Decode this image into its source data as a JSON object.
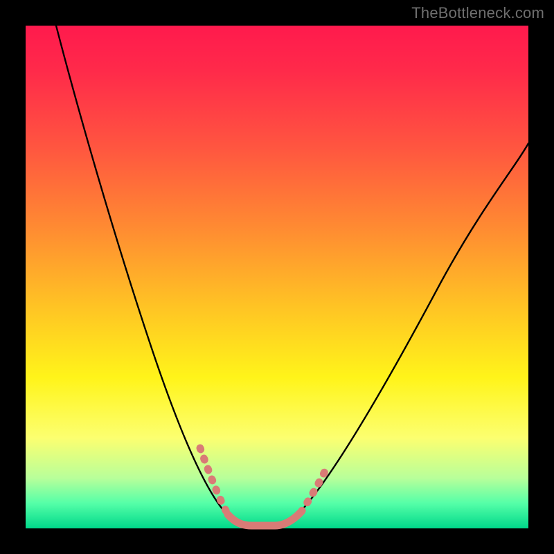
{
  "watermark": "TheBottleneck.com",
  "chart_data": {
    "type": "line",
    "title": "",
    "xlabel": "",
    "ylabel": "",
    "xlim": [
      0,
      100
    ],
    "ylim": [
      0,
      100
    ],
    "background": "rainbow-gradient-red-to-green",
    "series": [
      {
        "name": "bottleneck-curve",
        "x": [
          6,
          10,
          14,
          18,
          22,
          26,
          30,
          34,
          37,
          40,
          44,
          48,
          52,
          58,
          64,
          70,
          76,
          82,
          88,
          94,
          100
        ],
        "y": [
          100,
          86,
          72,
          60,
          48,
          37,
          27,
          18,
          10,
          3,
          0,
          0,
          3,
          10,
          20,
          31,
          42,
          53,
          62,
          70,
          77
        ]
      }
    ],
    "markers": {
      "name": "highlighted-range-salmon",
      "color": "#d97b76",
      "xrange": [
        34,
        56
      ]
    }
  }
}
